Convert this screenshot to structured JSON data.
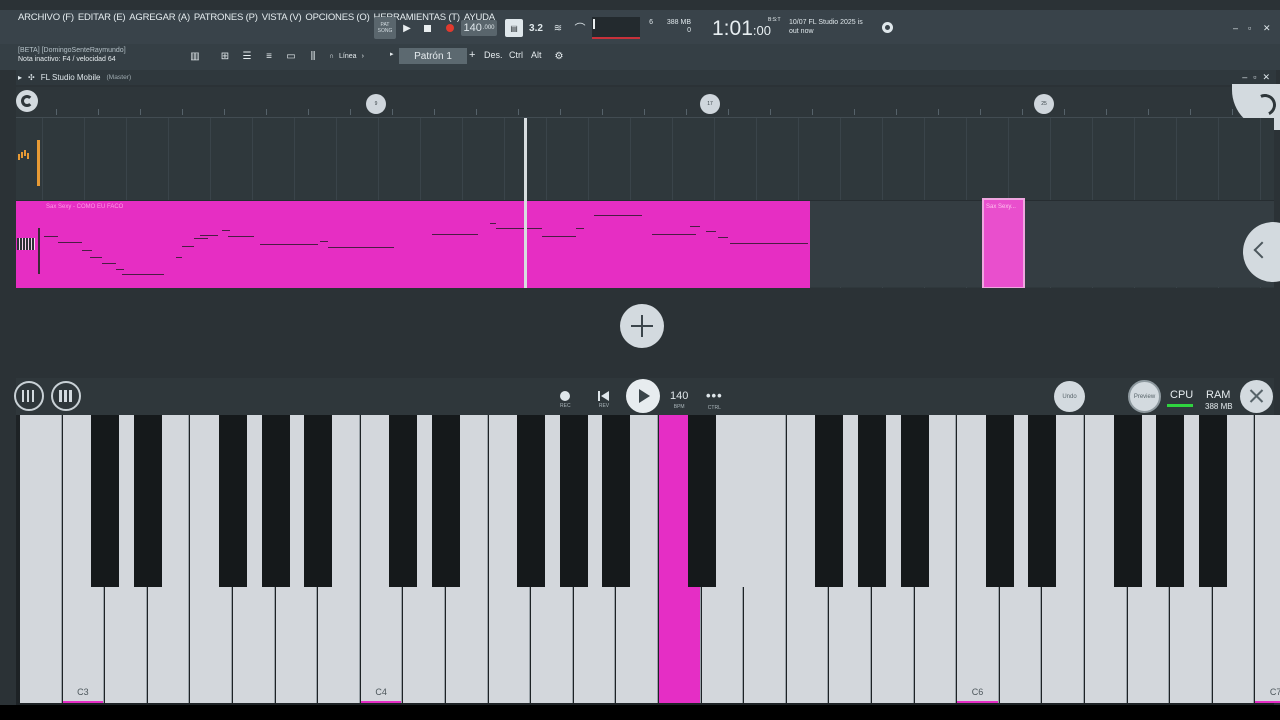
{
  "menu": [
    "ARCHIVO (F)",
    "EDITAR (E)",
    "AGREGAR (A)",
    "PATRONES (P)",
    "VISTA (V)",
    "OPCIONES (O)",
    "HERRAMIENTAS (T)",
    "AYUDA"
  ],
  "toolbar": {
    "pat_label": "PAT",
    "song_label": "SONG",
    "tempo": "140",
    "tempo_dec": ".000",
    "step_size": "3.2",
    "cpu_mini_top": "6",
    "cpu_mini_bot": "",
    "mem_top": "388 MB",
    "mem_bot": "0",
    "time": "1:01",
    "time_sub": ":00",
    "time_sup": "B:S:T",
    "news_date": "10/07",
    "news_line1": "FL Studio 2025 is",
    "news_line2": "out now"
  },
  "hint": {
    "line1": "[BETA] [DomingoSenteRaymundo]",
    "line2": "Nota inactivo: F4 / velocidad 64"
  },
  "toolbar2": {
    "mode": "Línea",
    "pattern": "Patrón 1",
    "btn_des": "Des.",
    "btn_ctrl": "Ctrl",
    "btn_alt": "Alt"
  },
  "window": {
    "title": "FL Studio Mobile",
    "subtitle": "(Master)"
  },
  "ruler": {
    "markers": [
      "9",
      "17",
      "25"
    ]
  },
  "clips": {
    "main_label": "Sax Sexy - COMO EU FACO",
    "small_label": "Sax Sexy..."
  },
  "transport": {
    "rec": "REC",
    "rev": "REV",
    "bpm": "140",
    "bpm_cap": "BPM",
    "ctrl_cap": "CTRL",
    "undo": "Undo",
    "preview": "Preview",
    "cpu": "CPU",
    "ram": "RAM",
    "ram_val": "388 MB"
  },
  "keyboard": {
    "labels": {
      "c3": "C3",
      "c4": "C4",
      "c6": "C6",
      "c7": "C7"
    }
  }
}
